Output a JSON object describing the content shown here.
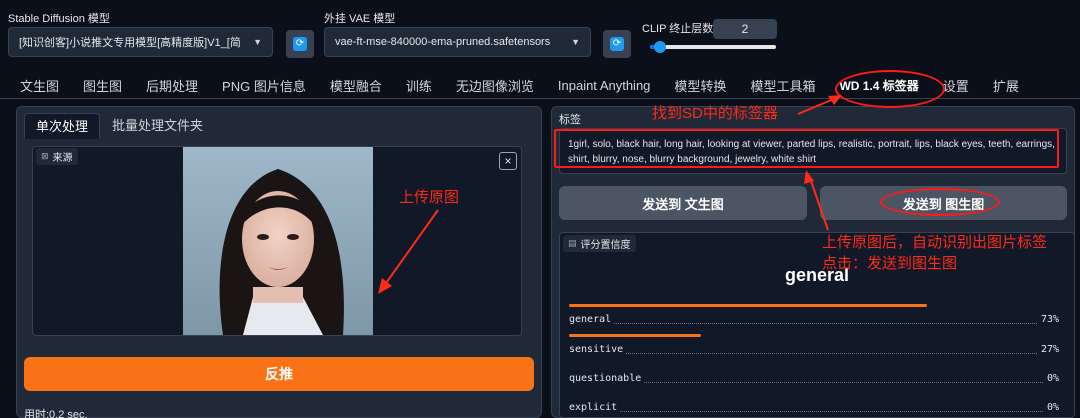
{
  "header": {
    "sd_model_label": "Stable Diffusion 模型",
    "sd_model_value": "[知识创客]小说推文专用模型[高精度版]V1_[简",
    "vae_label": "外挂 VAE 模型",
    "vae_value": "vae-ft-mse-840000-ema-pruned.safetensors",
    "clip_label": "CLIP 终止层数",
    "clip_value": "2",
    "clip_level": 0.083
  },
  "tabs": [
    "文生图",
    "图生图",
    "后期处理",
    "PNG 图片信息",
    "模型融合",
    "训练",
    "无边图像浏览",
    "Inpaint Anything",
    "模型转换",
    "模型工具箱",
    "WD 1.4 标签器",
    "设置",
    "扩展"
  ],
  "left": {
    "subtabs": [
      "单次处理",
      "批量处理文件夹"
    ],
    "source_label": "来源",
    "close_glyph": "×",
    "interrogate_button": "反推",
    "time_text": "用时:0.2 sec."
  },
  "right": {
    "tags_label": "标签",
    "tags_text": "1girl, solo, black hair, long hair, looking at viewer, parted lips, realistic, portrait, lips, black eyes, teeth, earrings, shirt, blurry, nose, blurry background, jewelry, white shirt",
    "send_txt2img": "发送到 文生图",
    "send_img2img": "发送到 图生图",
    "rating_label": "评分置信度",
    "rating_top": "general",
    "ratings": [
      {
        "name": "general",
        "value": "73%",
        "fraction": 0.73
      },
      {
        "name": "sensitive",
        "value": "27%",
        "fraction": 0.27
      },
      {
        "name": "questionable",
        "value": "0%",
        "fraction": 0.0
      },
      {
        "name": "explicit",
        "value": "0%",
        "fraction": 0.0
      }
    ]
  },
  "annotations": {
    "upload": "上传原图",
    "find_tagger": "找到SD中的标签器",
    "auto_tag_line1": "上传原图后，自动识别出图片标签",
    "auto_tag_line2": "点击：发送到图生图"
  },
  "colors": {
    "accent": "#f97316",
    "annotation_red": "#ff2a1a",
    "background": "#0b0f19",
    "panel": "#1f2937",
    "refresh_icon": "#1d9bf0"
  }
}
